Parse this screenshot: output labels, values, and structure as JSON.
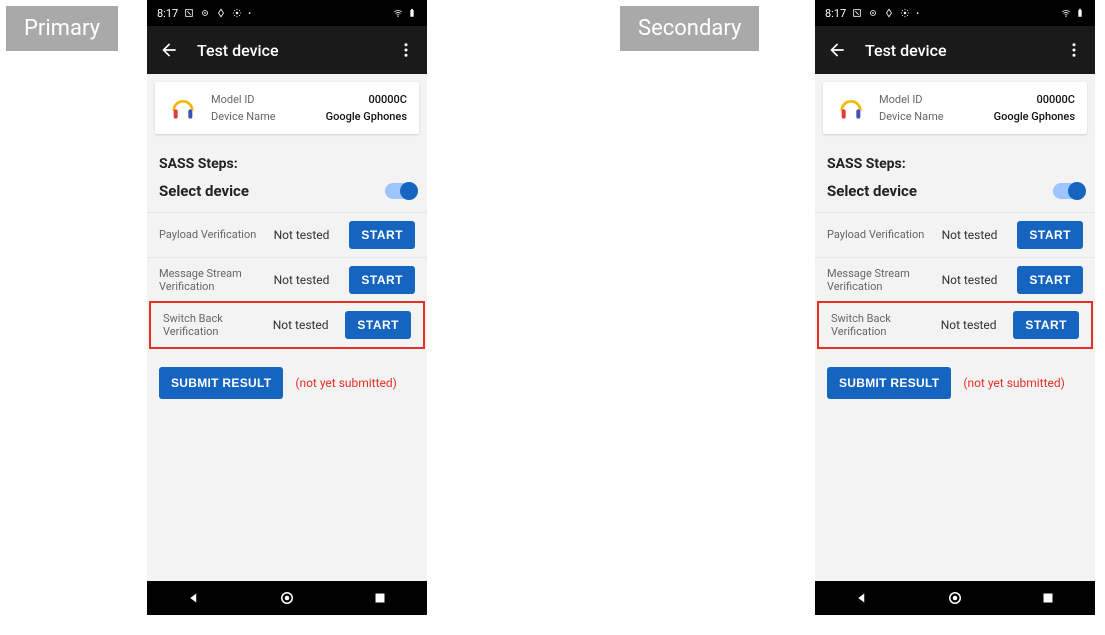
{
  "labels": {
    "primary": "Primary",
    "secondary": "Secondary"
  },
  "status": {
    "time": "8:17"
  },
  "appbar": {
    "title": "Test device"
  },
  "device": {
    "model_label": "Model ID",
    "model_value": "00000C",
    "name_label": "Device Name",
    "name_value": "Google Gphones"
  },
  "section": "SASS Steps:",
  "select": "Select device",
  "tests": [
    {
      "name": "Payload Verification",
      "status": "Not tested",
      "btn": "START"
    },
    {
      "name": "Message Stream Verification",
      "status": "Not tested",
      "btn": "START"
    },
    {
      "name": "Switch Back Verification",
      "status": "Not tested",
      "btn": "START"
    }
  ],
  "submit": {
    "btn": "SUBMIT RESULT",
    "note": "(not yet submitted)"
  }
}
